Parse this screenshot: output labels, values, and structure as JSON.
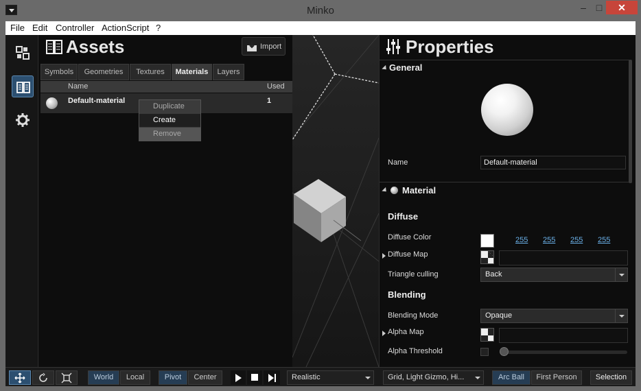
{
  "window": {
    "title": "Minko"
  },
  "menu": [
    "File",
    "Edit",
    "Controller",
    "ActionScript",
    "?"
  ],
  "iconbar": [
    {
      "icon": "scene-graph-icon",
      "active": false
    },
    {
      "icon": "assets-book-icon",
      "active": true
    },
    {
      "icon": "gear-icon",
      "active": false
    }
  ],
  "assets": {
    "title": "Assets",
    "import_label": "Import",
    "tabs": [
      "Symbols",
      "Geometries",
      "Textures",
      "Materials",
      "Layers"
    ],
    "active_tab": "Materials",
    "columns": [
      "Name",
      "Used"
    ],
    "rows": [
      {
        "name": "Default-material",
        "used": "1"
      }
    ],
    "context_menu": [
      "Duplicate",
      "Create",
      "Remove"
    ]
  },
  "properties": {
    "title": "Properties",
    "general": {
      "header": "General",
      "name_label": "Name",
      "name_value": "Default-material"
    },
    "material": {
      "header": "Material",
      "diffuse_header": "Diffuse",
      "diffuse_color_label": "Diffuse Color",
      "diffuse_rgba": [
        "255",
        "255",
        "255",
        "255"
      ],
      "diffuse_color": "#ffffff",
      "diffuse_map_label": "Diffuse Map",
      "triangle_culling_label": "Triangle culling",
      "triangle_culling_value": "Back",
      "blending_header": "Blending",
      "blending_mode_label": "Blending Mode",
      "blending_mode_value": "Opaque",
      "alpha_map_label": "Alpha Map",
      "alpha_threshold_label": "Alpha Threshold"
    }
  },
  "toolbar": {
    "transform_tools": [
      "translate-icon",
      "rotate-icon",
      "scale-icon"
    ],
    "space": [
      "World",
      "Local"
    ],
    "pivot": [
      "Pivot",
      "Center"
    ],
    "playback": [
      "play-icon",
      "stop-icon",
      "step-icon"
    ],
    "render_mode": "Realistic",
    "display_options": "Grid, Light Gizmo, Hi...",
    "camera": [
      "Arc Ball",
      "First Person"
    ],
    "selection_label": "Selection"
  }
}
